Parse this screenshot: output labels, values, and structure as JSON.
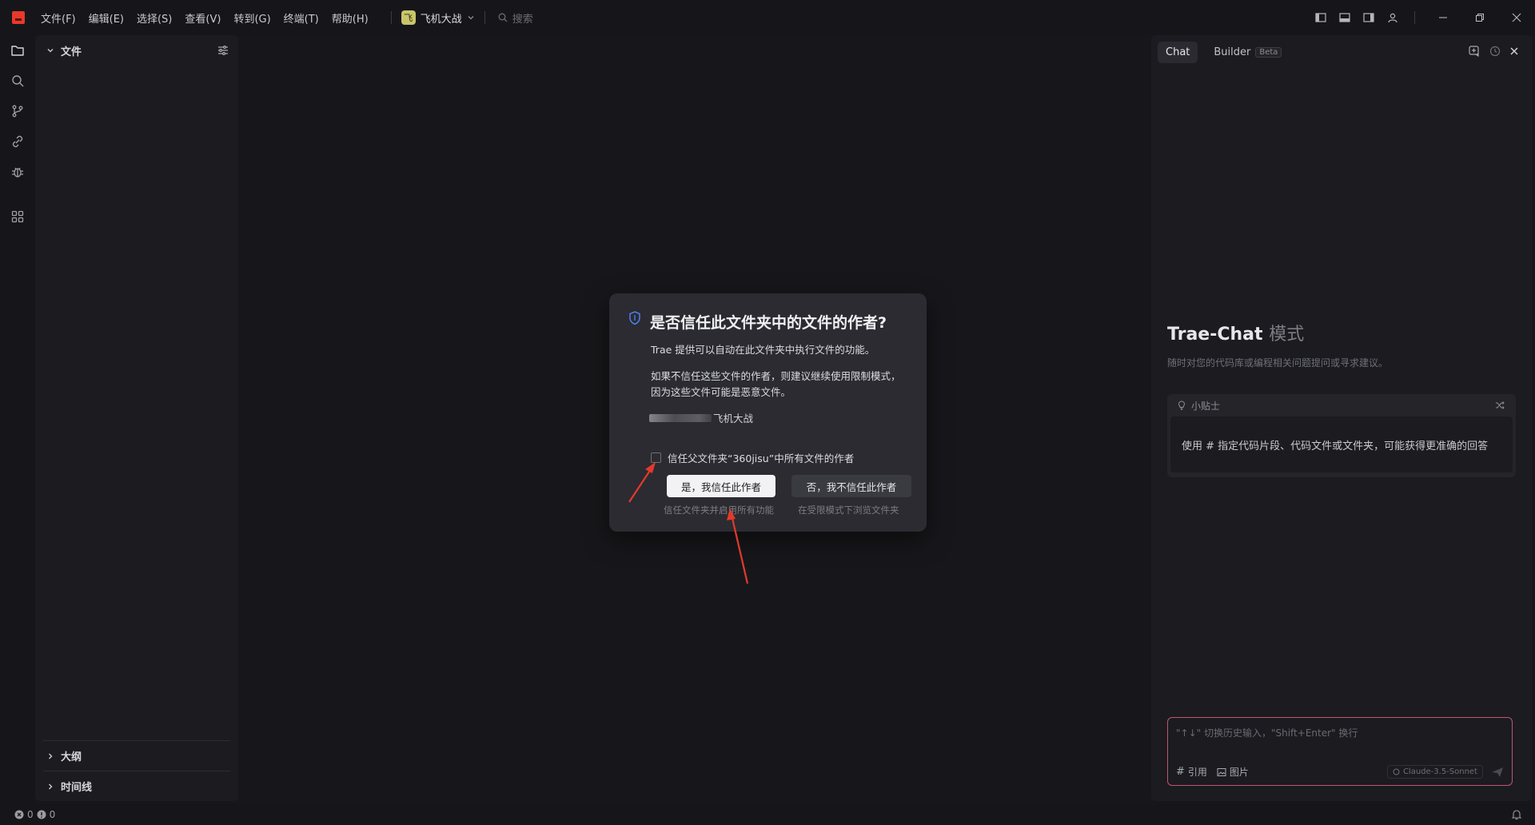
{
  "titlebar": {
    "menus": [
      "文件(F)",
      "编辑(E)",
      "选择(S)",
      "查看(V)",
      "转到(G)",
      "终端(T)",
      "帮助(H)"
    ],
    "project_badge": "飞",
    "project_name": "飞机大战",
    "search_placeholder": "搜索"
  },
  "explorer": {
    "title": "文件",
    "outline": "大纲",
    "timeline": "时间线"
  },
  "chat": {
    "tabs": {
      "chat": "Chat",
      "builder": "Builder",
      "beta": "Beta"
    },
    "title": "Trae-Chat",
    "title_mode": "模式",
    "description": "随时对您的代码库或编程相关问题提问或寻求建议。",
    "tip_label": "小贴士",
    "tip_text": "使用 # 指定代码片段、代码文件或文件夹，可能获得更准确的回答",
    "input_placeholder": "\"↑↓\" 切换历史输入，\"Shift+Enter\" 换行",
    "tool_reference": "引用",
    "tool_image": "图片",
    "model": "Claude-3.5-Sonnet"
  },
  "dialog": {
    "title": "是否信任此文件夹中的文件的作者?",
    "line1": "Trae 提供可以自动在此文件夹中执行文件的功能。",
    "line2": "如果不信任这些文件的作者，则建议继续使用限制模式，",
    "line3": "因为这些文件可能是恶意文件。",
    "path_suffix": "飞机大战",
    "checkbox_label": "信任父文件夹“360jisu”中所有文件的作者",
    "trust_button": "是，我信任此作者",
    "trust_sub": "信任文件夹并启用所有功能",
    "notrust_button": "否，我不信任此作者",
    "notrust_sub": "在受限模式下浏览文件夹"
  },
  "statusbar": {
    "errors": "0",
    "warnings": "0"
  },
  "colors": {
    "accent_red": "#e8392b",
    "annotation_arrow": "#e23a2c",
    "input_border": "#c2566e"
  }
}
